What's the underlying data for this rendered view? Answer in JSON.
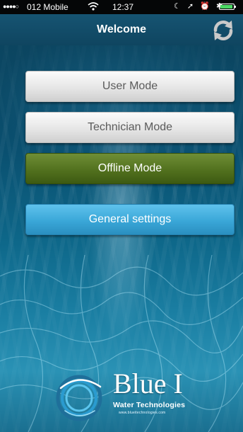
{
  "status_bar": {
    "signal": "●●●●○",
    "carrier": "012 Mobile",
    "wifi_icon": "wifi-icon",
    "time": "12:37",
    "icons": "☾ ➚ ⏰ ✱",
    "battery_icon": "battery-icon"
  },
  "nav": {
    "title": "Welcome",
    "refresh_icon": "refresh-icon"
  },
  "menu": {
    "user_mode": "User Mode",
    "technician_mode": "Technician Mode",
    "offline_mode": "Offline Mode",
    "general_settings": "General settings"
  },
  "logo": {
    "brand": "Blue I",
    "tagline": "Water Technologies",
    "url": "www.blueitechnologies.com"
  },
  "colors": {
    "nav_bg": "#165472",
    "offline_button": "#52711e",
    "settings_button": "#3aa7d8",
    "mode_button": "#e6e6e6"
  }
}
